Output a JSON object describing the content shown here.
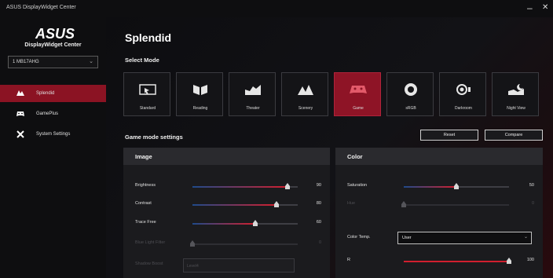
{
  "window": {
    "title": "ASUS DisplayWidget Center",
    "minimize": "–",
    "close": "✕"
  },
  "sidebar": {
    "logo": "ASUS",
    "app_name": "DisplayWidget Center",
    "monitor": "1 MB17AHG",
    "items": [
      {
        "label": "Splendid",
        "icon": "splendid-icon",
        "active": true
      },
      {
        "label": "GamePlus",
        "icon": "gamepad-icon",
        "active": false
      },
      {
        "label": "System Settings",
        "icon": "tools-icon",
        "active": false
      }
    ]
  },
  "main": {
    "title": "Splendid",
    "select_mode_label": "Select Mode",
    "modes": [
      {
        "label": "Standard",
        "icon": "standard-icon"
      },
      {
        "label": "Reading",
        "icon": "reading-icon"
      },
      {
        "label": "Theater",
        "icon": "theater-icon"
      },
      {
        "label": "Scenery",
        "icon": "scenery-icon"
      },
      {
        "label": "Game",
        "icon": "game-icon",
        "active": true
      },
      {
        "label": "sRGB",
        "icon": "srgb-icon"
      },
      {
        "label": "Darkroom",
        "icon": "darkroom-icon"
      },
      {
        "label": "Night View",
        "icon": "night-view-icon"
      }
    ],
    "section_title": "Game mode settings",
    "reset_label": "Reset",
    "compare_label": "Compare",
    "image_panel": {
      "title": "Image",
      "sliders": [
        {
          "label": "Brightness",
          "value": "90",
          "level": 0.9,
          "enabled": true
        },
        {
          "label": "Contrast",
          "value": "80",
          "level": 0.8,
          "enabled": true
        },
        {
          "label": "Trace Free",
          "value": "60",
          "level": 0.6,
          "enabled": true
        },
        {
          "label": "Blue Light Filter",
          "value": "0",
          "level": 0,
          "enabled": false
        }
      ],
      "shadow_boost_label": "Shadow Boost",
      "shadow_boost_value": "Level4"
    },
    "color_panel": {
      "title": "Color",
      "sliders": [
        {
          "label": "Saturation",
          "value": "50",
          "level": 0.5,
          "enabled": true
        },
        {
          "label": "Hue",
          "value": "0",
          "level": 0,
          "enabled": false
        }
      ],
      "color_temp_label": "Color Temp.",
      "color_temp_value": "User",
      "r_label": "R",
      "r_value": "100",
      "r_level": 1.0
    }
  },
  "colors": {
    "accent": "#8e1426",
    "gradient_start": "#1f4a8a",
    "gradient_end": "#d11f2e"
  }
}
